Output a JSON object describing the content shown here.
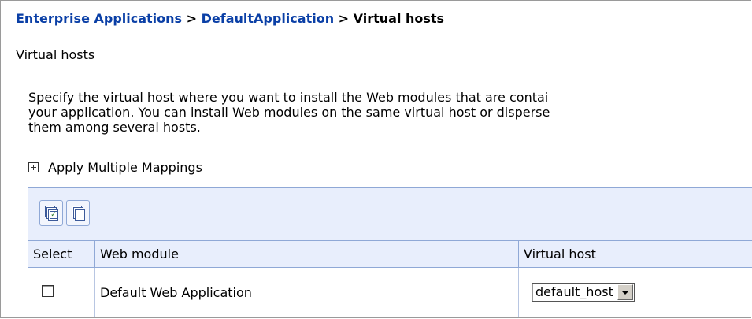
{
  "breadcrumb": {
    "link1": "Enterprise Applications",
    "sep1": " > ",
    "link2": "DefaultApplication",
    "sep2": " > ",
    "current": "Virtual hosts"
  },
  "page_title": "Virtual hosts",
  "description": {
    "line1": "Specify the virtual host where you want to install the Web modules that are contai",
    "line2": "your application. You can install Web modules on the same virtual host or disperse",
    "line3": "them among several hosts."
  },
  "multiple_mappings": {
    "label": "Apply Multiple Mappings",
    "icon": "expand-plus-icon"
  },
  "toolbar": {
    "buttons": [
      {
        "icon": "select-all-icon"
      },
      {
        "icon": "deselect-all-icon"
      }
    ]
  },
  "table": {
    "headers": {
      "select": "Select",
      "module": "Web module",
      "host": "Virtual host"
    },
    "rows": [
      {
        "checked": false,
        "module": "Default Web Application",
        "host": "default_host"
      }
    ]
  }
}
